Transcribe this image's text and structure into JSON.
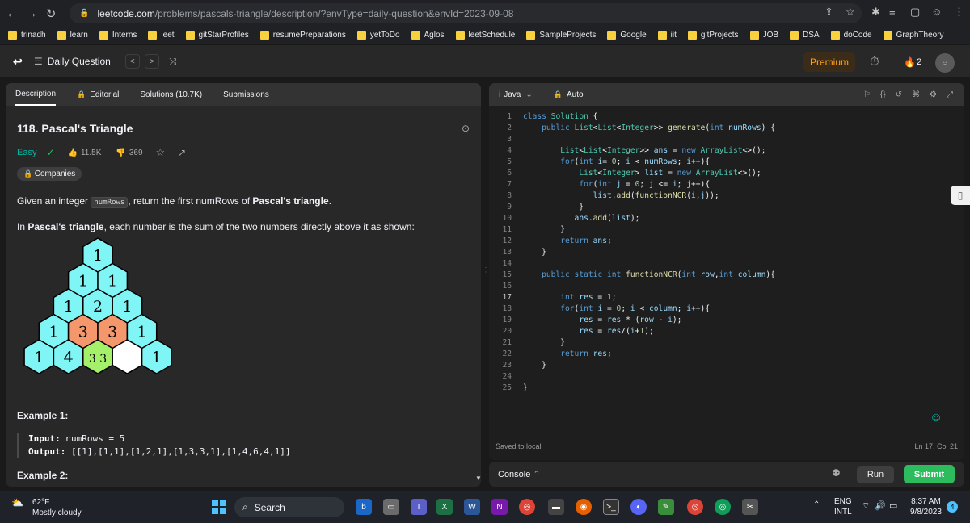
{
  "browser": {
    "url_host": "leetcode.com",
    "url_path": "/problems/pascals-triangle/description/?envType=daily-question&envId=2023-09-08"
  },
  "bookmarks": [
    "trinadh",
    "learn",
    "Interns",
    "leet",
    "gitStarProfiles",
    "resumePreparations",
    "yetToDo",
    "Aglos",
    "leetSchedule",
    "SampleProjects",
    "Google",
    "iit",
    "gitProjects",
    "JOB",
    "DSA",
    "doCode",
    "GraphTheory"
  ],
  "header": {
    "daily_label": "Daily Question",
    "premium_label": "Premium",
    "streak_count": "2"
  },
  "left_tabs": {
    "description": "Description",
    "editorial": "Editorial",
    "solutions": "Solutions (10.7K)",
    "submissions": "Submissions"
  },
  "problem": {
    "title": "118. Pascal's Triangle",
    "difficulty": "Easy",
    "likes": "11.5K",
    "dislikes": "369",
    "companies": "Companies",
    "p1_a": "Given an integer ",
    "p1_code": "numRows",
    "p1_b": ", return the first numRows of ",
    "p1_bold": "Pascal's triangle",
    "p1_end": ".",
    "p2_a": "In ",
    "p2_bold": "Pascal's triangle",
    "p2_b": ", each number is the sum of the two numbers directly above it as shown:",
    "example1_title": "Example 1:",
    "example1_input_label": "Input:",
    "example1_input": "numRows = 5",
    "example1_output_label": "Output:",
    "example1_output": "[[1],[1,1],[1,2,1],[1,3,3,1],[1,4,6,4,1]]",
    "example2_title": "Example 2:"
  },
  "triangle_rows": [
    [
      "1"
    ],
    [
      "1",
      "1"
    ],
    [
      "1",
      "2",
      "1"
    ],
    [
      "1",
      "3",
      "3",
      "1"
    ],
    [
      "1",
      "4",
      "3 3",
      "",
      "1"
    ]
  ],
  "editor": {
    "language": "Java",
    "mode": "Auto",
    "saved_status": "Saved to local",
    "cursor_pos": "Ln 17, Col 21"
  },
  "code_lines": [
    "class Solution {",
    "    public List<List<Integer>> generate(int numRows) {",
    "",
    "        List<List<Integer>> ans = new ArrayList<>();",
    "        for(int i= 0; i < numRows; i++){",
    "            List<Integer> list = new ArrayList<>();",
    "            for(int j = 0; j <= i; j++){",
    "               list.add(functionNCR(i,j));",
    "            }",
    "           ans.add(list);",
    "        }",
    "        return ans;",
    "    }",
    "",
    "    public static int functionNCR(int row,int column){",
    "",
    "        int res = 1;",
    "        for(int i = 0; i < column; i++){",
    "            res = res * (row - i);",
    "            res = res/(i+1);",
    "        }",
    "        return res;",
    "    }",
    "",
    "}"
  ],
  "console": {
    "console_label": "Console",
    "run_label": "Run",
    "submit_label": "Submit"
  },
  "taskbar": {
    "temp": "62°F",
    "weather": "Mostly cloudy",
    "search_label": "Search",
    "lang1": "ENG",
    "lang2": "INTL",
    "time": "8:37 AM",
    "date": "9/8/2023",
    "notif_count": "4"
  },
  "colors": {
    "accent": "#ffa116",
    "easy": "#00b8a3",
    "submit": "#2cbb5d",
    "hex_cyan": "#7ff5f5",
    "hex_orange": "#f4976c",
    "hex_green": "#a5f06a"
  }
}
